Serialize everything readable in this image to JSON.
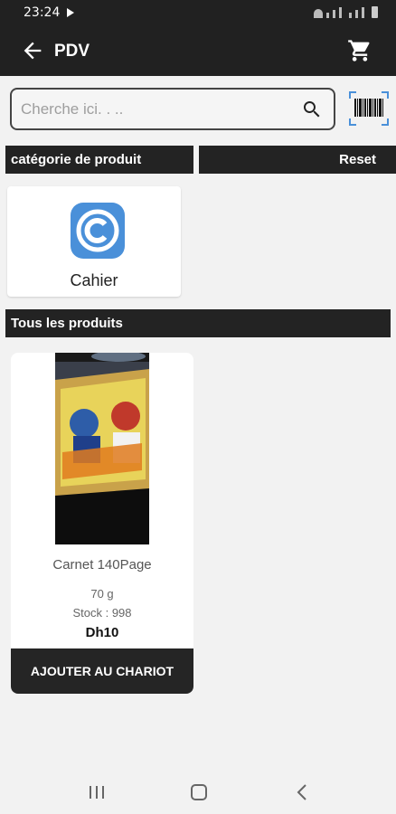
{
  "status_bar": {
    "time": "23:24"
  },
  "header": {
    "title": "PDV"
  },
  "search": {
    "placeholder": "Cherche ici. . .."
  },
  "category_section": {
    "label": "catégorie de produit",
    "reset_label": "Reset"
  },
  "categories": [
    {
      "label": "Cahier",
      "icon": "copyright-circle-icon",
      "color": "#4a90d9"
    }
  ],
  "products_section": {
    "label": "Tous les produits"
  },
  "products": [
    {
      "name": "Carnet 140Page",
      "weight": "70 g",
      "stock": "Stock : 998",
      "price": "Dh10",
      "button_label": "AJOUTER AU CHARIOT"
    }
  ],
  "colors": {
    "appbar": "#212121",
    "section_bar": "#232323",
    "accent": "#4a90d9"
  }
}
